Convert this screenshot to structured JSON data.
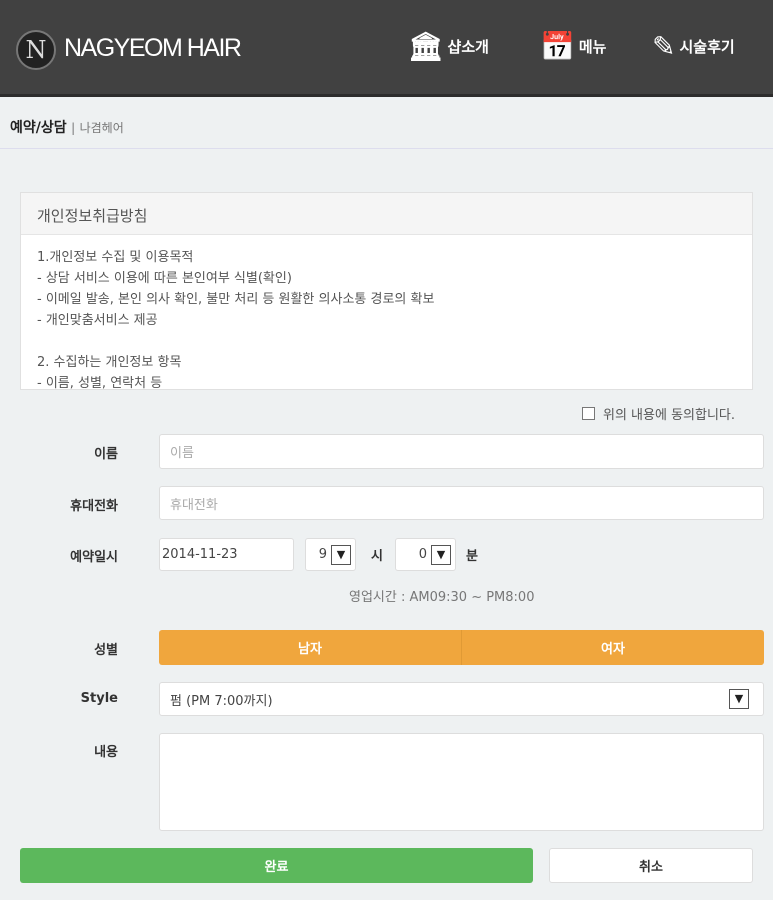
{
  "header": {
    "logo_mark": "N",
    "brand": "NAGYEOM HAIR",
    "nav": [
      {
        "label": "샵소개",
        "icon": "bank-icon"
      },
      {
        "label": "메뉴",
        "icon": "calendar-icon"
      },
      {
        "label": "시술후기",
        "icon": "edit-icon"
      }
    ]
  },
  "breadcrumb": {
    "current": "예약/상담",
    "separator": "|",
    "site": "나겸헤어"
  },
  "policy": {
    "title": "개인정보취급방침",
    "body": "1.개인정보 수집 및 이용목적\n- 상담 서비스 이용에 따른 본인여부 식별(확인)\n- 이메일 발송, 본인 의사 확인, 불만 처리 등 원활한 의사소통 경로의 확보\n- 개인맞춤서비스 제공\n\n2. 수집하는 개인정보 항목\n- 이름, 성별, 연락처 등"
  },
  "agree_label": "위의 내용에 동의합니다.",
  "form": {
    "name": {
      "label": "이름",
      "placeholder": "이름"
    },
    "phone": {
      "label": "휴대전화",
      "placeholder": "휴대전화"
    },
    "datetime": {
      "label": "예약일시",
      "date": "2014-11-23",
      "hour": "9",
      "hour_unit": "시",
      "minute": "0",
      "minute_unit": "분",
      "hours_note": "영업시간 : AM09:30 ~ PM8:00"
    },
    "gender": {
      "label": "성별",
      "options": [
        "남자",
        "여자"
      ]
    },
    "style": {
      "label": "Style",
      "value": "펌 (PM 7:00까지)"
    },
    "content": {
      "label": "내용"
    }
  },
  "buttons": {
    "submit": "완료",
    "cancel": "취소"
  },
  "colors": {
    "header": "#414141",
    "gender": "#f0a63d",
    "submit": "#5cb85c"
  }
}
